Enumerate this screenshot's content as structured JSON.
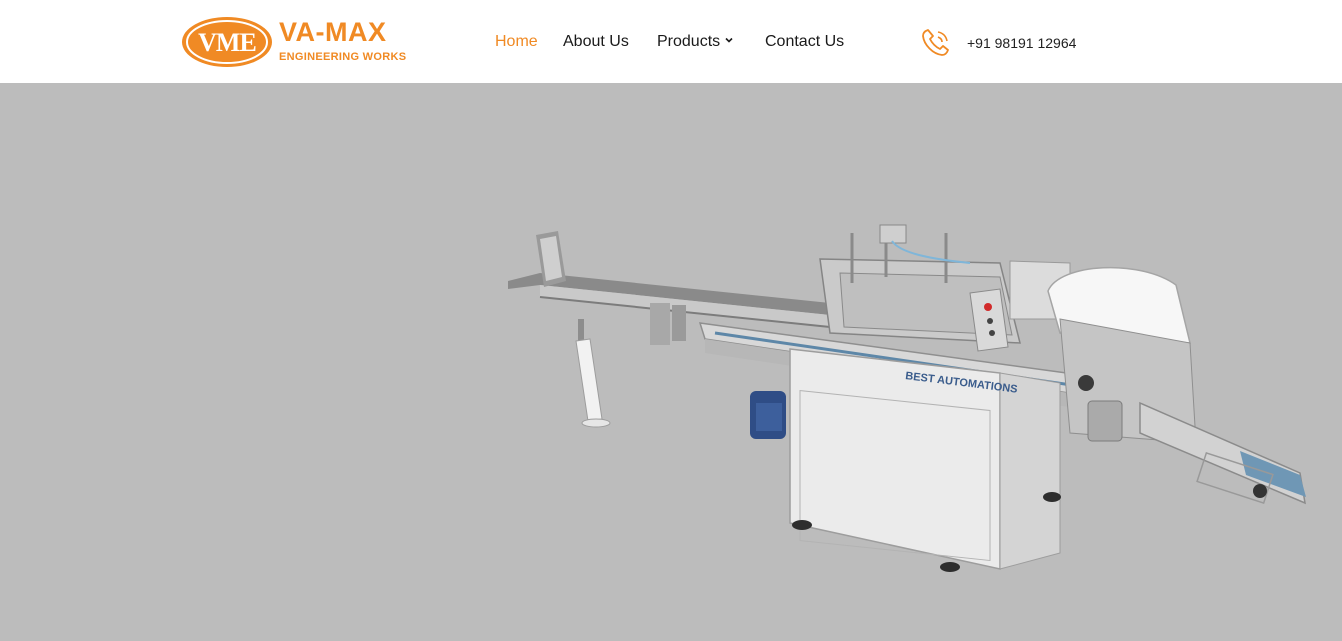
{
  "brand": {
    "monogram": "VME",
    "name": "VA-MAX",
    "tagline": "ENGINEERING WORKS",
    "color": "#f08a24"
  },
  "nav": {
    "home": "Home",
    "about": "About Us",
    "products": "Products",
    "contact": "Contact Us",
    "active": "Home"
  },
  "contact": {
    "phone": "+91 98191 12964",
    "icon": "phone-icon"
  },
  "hero": {
    "background": "#bcbcbc",
    "image": "packaging-machine",
    "machine_labels": [
      "BEST AUTOMATIONS"
    ]
  }
}
